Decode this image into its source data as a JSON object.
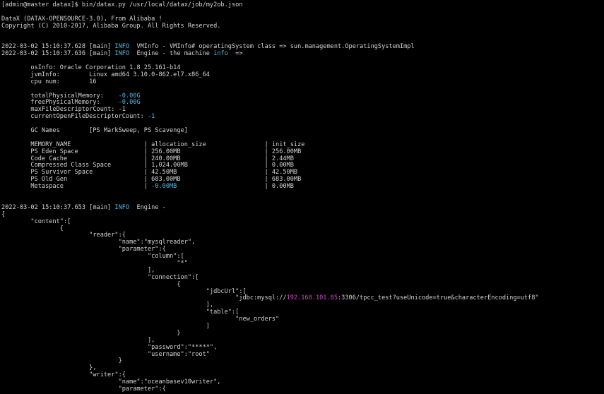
{
  "terminal": {
    "colors": {
      "background": "#000000",
      "text": "#d4d4d4",
      "info": "#4fb8e8",
      "number": "#4fb8e8",
      "ip": "#d246c8"
    },
    "lines": [
      [
        {
          "t": "[admin@master datax]$ bin/datax.py /usr/local/datax/job/my2ob.json"
        }
      ],
      [
        {
          "t": ""
        }
      ],
      [
        {
          "t": "DataX (DATAX-OPENSOURCE-3.0), From Alibaba !"
        }
      ],
      [
        {
          "t": "Copyright (C) 2010-2017, Alibaba Group. All Rights Reserved."
        }
      ],
      [
        {
          "t": ""
        }
      ],
      [
        {
          "t": ""
        }
      ],
      [
        {
          "t": "2022-03-02 15:10:37.628 [main] "
        },
        {
          "t": "INFO",
          "c": "info"
        },
        {
          "t": "  VMInfo - VMInfo# operatingSystem class => sun.management.OperatingSystemImpl"
        }
      ],
      [
        {
          "t": "2022-03-02 15:10:37.636 [main] "
        },
        {
          "t": "INFO",
          "c": "info"
        },
        {
          "t": "  Engine - the machine "
        },
        {
          "t": "info",
          "c": "info"
        },
        {
          "t": "  =>"
        }
      ],
      [
        {
          "t": ""
        }
      ],
      [
        {
          "t": "        osInfo: Oracle Corporation 1.8 25.161-b14"
        }
      ],
      [
        {
          "t": "        jvmInfo:        Linux amd64 3.10.0-862.el7.x86_64"
        }
      ],
      [
        {
          "t": "        cpu num:        16"
        }
      ],
      [
        {
          "t": ""
        }
      ],
      [
        {
          "t": "        totalPhysicalMemory:    "
        },
        {
          "t": "-0.00G",
          "c": "num"
        }
      ],
      [
        {
          "t": "        freePhysicalMemory:     "
        },
        {
          "t": "-0.00G",
          "c": "num"
        }
      ],
      [
        {
          "t": "        maxFileDescriptorCount: -1"
        }
      ],
      [
        {
          "t": "        currentOpenFileDescriptorCount: "
        },
        {
          "t": "-1",
          "c": "num"
        }
      ],
      [
        {
          "t": ""
        }
      ],
      [
        {
          "t": "        GC Names        [PS MarkSweep, PS Scavenge]"
        }
      ],
      [
        {
          "t": ""
        }
      ],
      [
        {
          "t": "        MEMORY_NAME                    | allocation_size                | init_size"
        }
      ],
      [
        {
          "t": "        PS Eden Space                  | 256.00MB                       | 256.00MB"
        }
      ],
      [
        {
          "t": "        Code Cache                     | 240.00MB                       | 2.44MB"
        }
      ],
      [
        {
          "t": "        Compressed Class Space         | 1,024.00MB                     | 0.00MB"
        }
      ],
      [
        {
          "t": "        PS Survivor Space              | 42.50MB                        | 42.50MB"
        }
      ],
      [
        {
          "t": "        PS Old Gen                     | 683.00MB                       | 683.00MB"
        }
      ],
      [
        {
          "t": "        Metaspace                      | "
        },
        {
          "t": "-0.00MB",
          "c": "num"
        },
        {
          "t": "                        | 0.00MB"
        }
      ],
      [
        {
          "t": ""
        }
      ],
      [
        {
          "t": ""
        }
      ],
      [
        {
          "t": "2022-03-02 15:10:37.653 [main] "
        },
        {
          "t": "INFO",
          "c": "info"
        },
        {
          "t": "  Engine -"
        }
      ],
      [
        {
          "t": "{"
        }
      ],
      [
        {
          "t": "        \"content\":["
        }
      ],
      [
        {
          "t": "                {"
        }
      ],
      [
        {
          "t": "                        \"reader\":{"
        }
      ],
      [
        {
          "t": "                                \"name\":\"mysqlreader\","
        }
      ],
      [
        {
          "t": "                                \"parameter\":{"
        }
      ],
      [
        {
          "t": "                                        \"column\":["
        }
      ],
      [
        {
          "t": "                                                \"*\""
        }
      ],
      [
        {
          "t": "                                        ],"
        }
      ],
      [
        {
          "t": "                                        \"connection\":["
        }
      ],
      [
        {
          "t": "                                                {"
        }
      ],
      [
        {
          "t": "                                                        \"jdbcUrl\":["
        }
      ],
      [
        {
          "t": "                                                                \"jdbc:mysql://"
        },
        {
          "t": "192.168.101.85",
          "c": "ip"
        },
        {
          "t": ":3306/tpcc_test?useUnicode=true&characterEncoding=utf8\""
        }
      ],
      [
        {
          "t": "                                                        ],"
        }
      ],
      [
        {
          "t": "                                                        \"table\":["
        }
      ],
      [
        {
          "t": "                                                                \"new_orders\""
        }
      ],
      [
        {
          "t": "                                                        ]"
        }
      ],
      [
        {
          "t": "                                                }"
        }
      ],
      [
        {
          "t": "                                        ],"
        }
      ],
      [
        {
          "t": "                                        \"password\":\"*****\","
        }
      ],
      [
        {
          "t": "                                        \"username\":\"root\""
        }
      ],
      [
        {
          "t": "                                }"
        }
      ],
      [
        {
          "t": "                        },"
        }
      ],
      [
        {
          "t": "                        \"writer\":{"
        }
      ],
      [
        {
          "t": "                                \"name\":\"oceanbasev10writer\","
        }
      ],
      [
        {
          "t": "                                \"parameter\":{"
        }
      ]
    ]
  }
}
